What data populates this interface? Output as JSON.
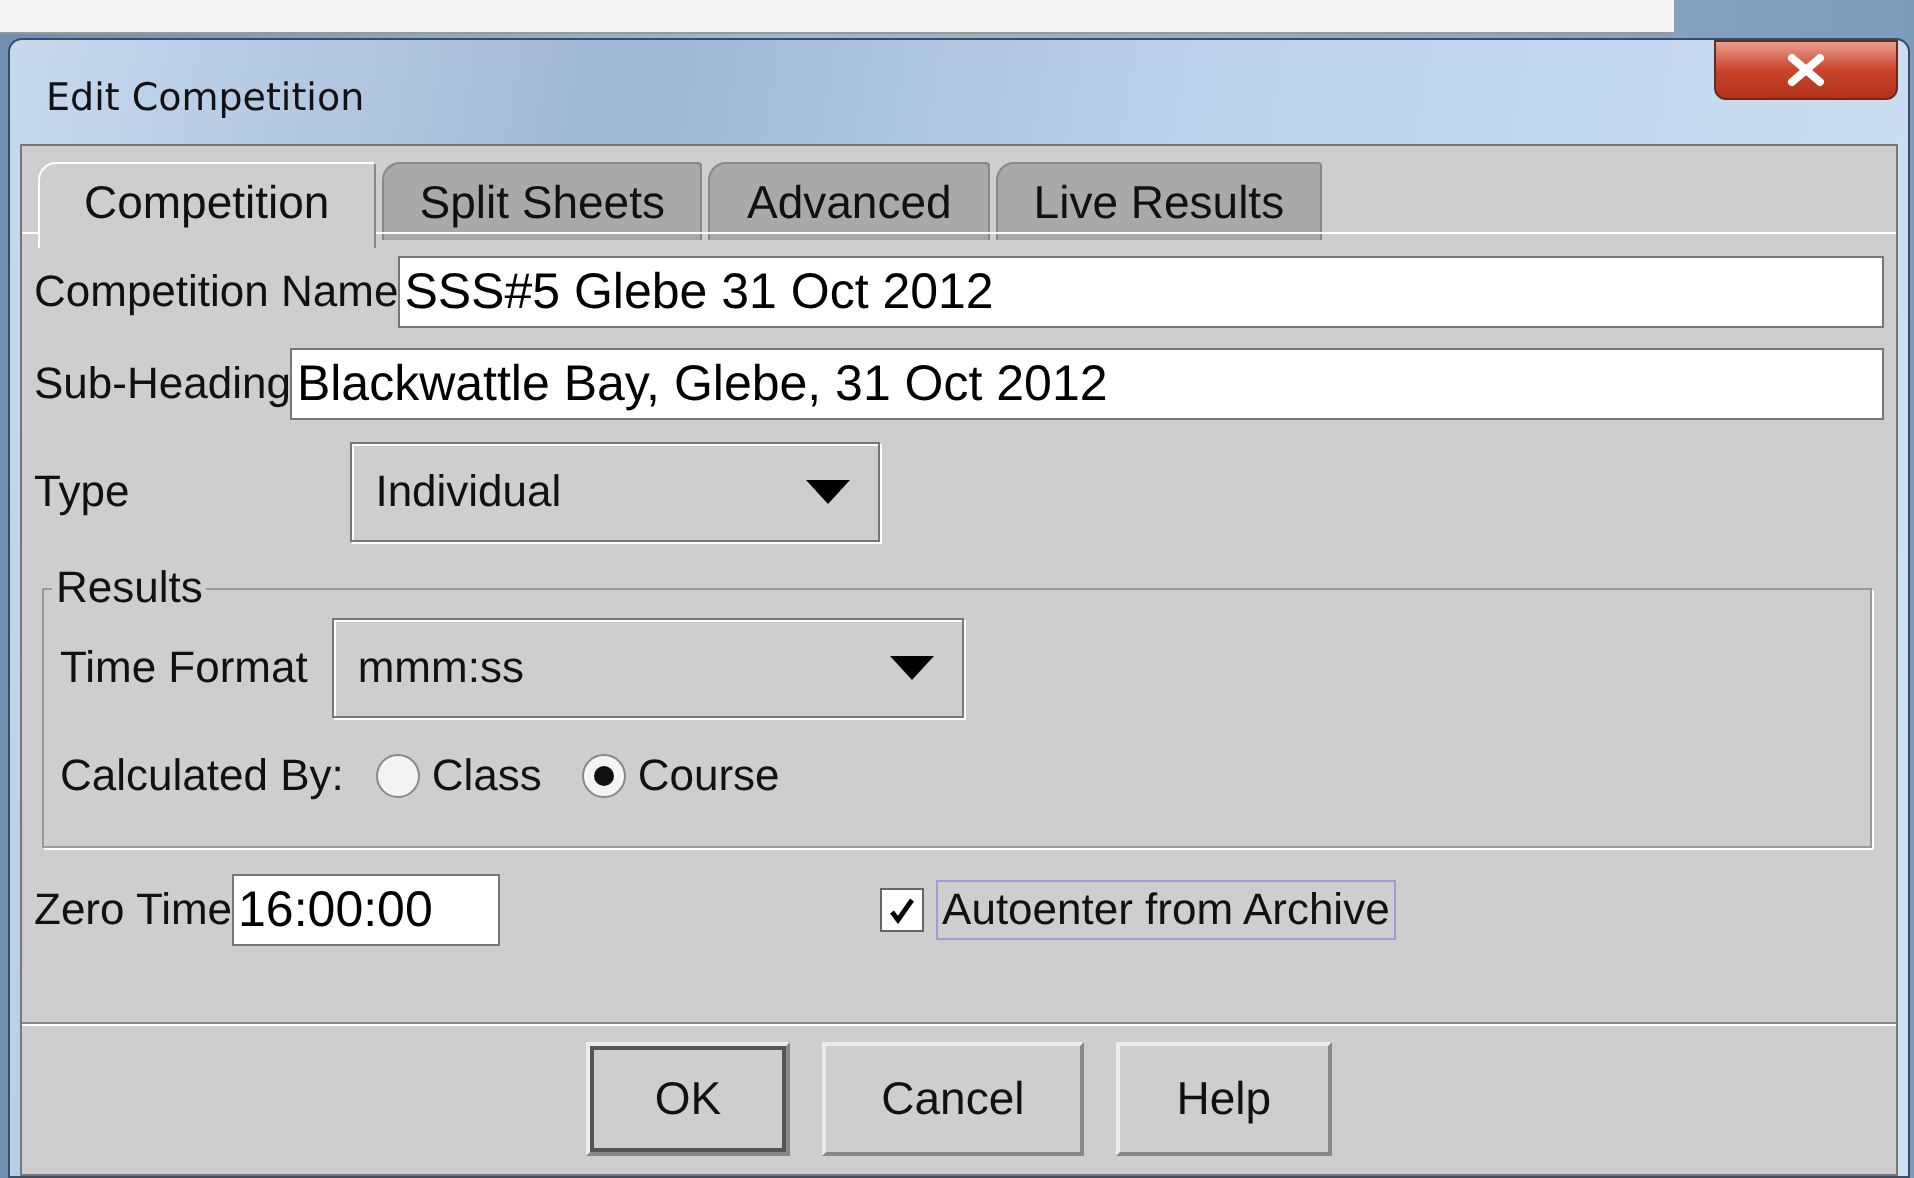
{
  "window": {
    "title": "Edit Competition"
  },
  "tabs": [
    {
      "label": "Competition",
      "selected": true
    },
    {
      "label": "Split Sheets",
      "selected": false
    },
    {
      "label": "Advanced",
      "selected": false
    },
    {
      "label": "Live Results",
      "selected": false
    }
  ],
  "fields": [
    {
      "kind": "text",
      "label": "Competition Name",
      "value": "SSS#5 Glebe 31 Oct 2012"
    },
    {
      "kind": "text",
      "label": "Sub-Heading",
      "value": "Blackwattle Bay, Glebe, 31 Oct 2012"
    },
    {
      "kind": "dropdown",
      "label": "Type",
      "value": "Individual"
    }
  ],
  "results": {
    "title": "Results",
    "time_format": {
      "label": "Time Format",
      "value": "mmm:ss"
    },
    "calculated_by": {
      "label": "Calculated By:",
      "options": [
        {
          "label": "Class",
          "selected": false
        },
        {
          "label": "Course",
          "selected": true
        }
      ]
    }
  },
  "zero_time": {
    "label": "Zero Time",
    "value": "16:00:00"
  },
  "autoenter": {
    "label": "Autoenter from Archive",
    "checked": true
  },
  "buttons": [
    {
      "label": "OK",
      "default": true
    },
    {
      "label": "Cancel",
      "default": false
    },
    {
      "label": "Help",
      "default": false
    }
  ]
}
